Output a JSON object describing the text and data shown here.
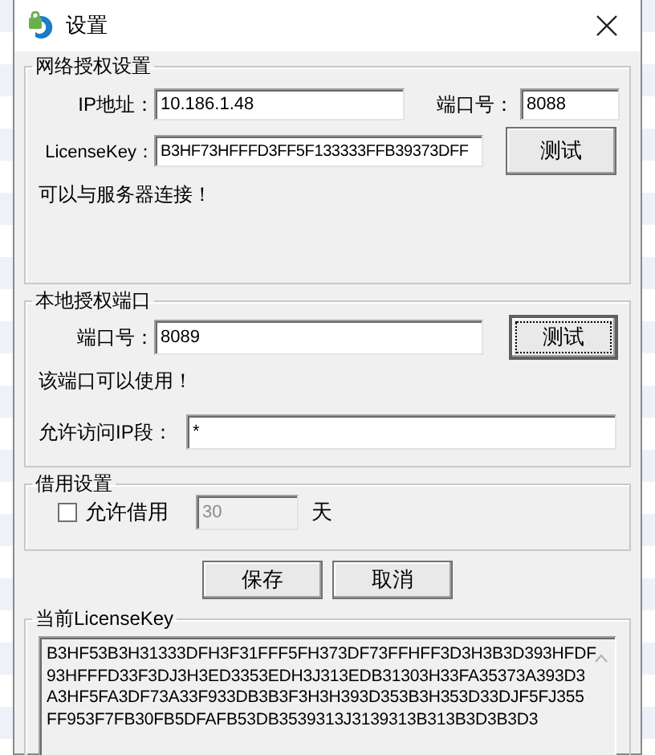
{
  "window": {
    "title": "设置"
  },
  "network_auth": {
    "title": "网络授权设置",
    "ip_label": "IP地址：",
    "ip_value": "10.186.1.48",
    "port_label": "端口号：",
    "port_value": "8088",
    "key_label": "LicenseKey：",
    "key_value": "B3HF73HFFFD3FF5F133333FFB39373DFF",
    "test_button": "测试",
    "status": "可以与服务器连接！"
  },
  "local_port": {
    "title": "本地授权端口",
    "port_label": "端口号：",
    "port_value": "8089",
    "test_button": "测试",
    "status": "该端口可以使用！",
    "ip_range_label": "允许访问IP段：",
    "ip_range_value": "*"
  },
  "borrow": {
    "title": "借用设置",
    "allow_label": "允许借用",
    "checked": false,
    "days_value": "30",
    "days_unit": "天"
  },
  "buttons": [
    "保存",
    "取消"
  ],
  "current_key": {
    "title": "当前LicenseKey",
    "lines": [
      "B3HF53B3H31333DFH3F31FFF5FH373DF73FFHFF3D3H3B3D393HFDF",
      "93HFFFD33F3DJ3H3ED3353EDH3J313EDB31303H33FA35373A393D3",
      "A3HF5FA3DF73A33F933DB3B3F3H3H393D353B3H353D33DJF5FJ355",
      "FF953F7FB30FB5DFAFB53DB3539313J3139313B313B3D3B3D3"
    ]
  }
}
